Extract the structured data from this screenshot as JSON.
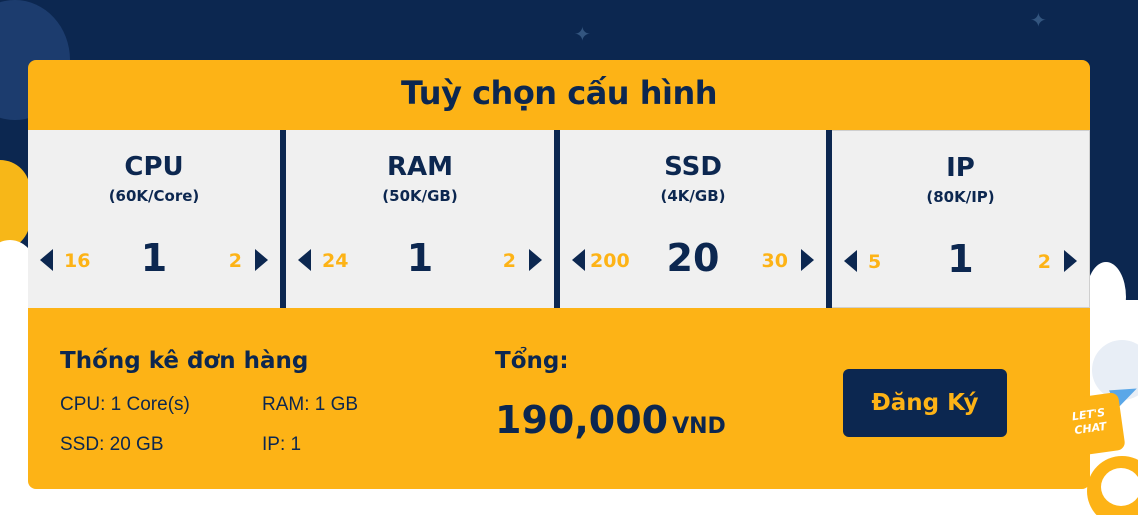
{
  "title": "Tuỳ chọn cấu hình",
  "options": [
    {
      "name": "CPU",
      "price": "(60K/Core)",
      "prev": "16",
      "value": "1",
      "next": "2"
    },
    {
      "name": "RAM",
      "price": "(50K/GB)",
      "prev": "24",
      "value": "1",
      "next": "2"
    },
    {
      "name": "SSD",
      "price": "(4K/GB)",
      "prev": "200",
      "value": "20",
      "next": "30"
    },
    {
      "name": "IP",
      "price": "(80K/IP)",
      "prev": "5",
      "value": "1",
      "next": "2"
    }
  ],
  "summary": {
    "title": "Thống kê đơn hàng",
    "cpu": "CPU:  1 Core(s)",
    "ram": "RAM:  1 GB",
    "ssd": "SSD:  20 GB",
    "ip": "IP:  1"
  },
  "total": {
    "label": "Tổng:",
    "value": "190,000",
    "unit": "VND"
  },
  "register_label": "Đăng Ký",
  "chat_badge": {
    "line1": "LET'S",
    "line2": "CHAT"
  },
  "colors": {
    "navy": "#0c2750",
    "accent": "#fdb316",
    "panel": "#f0f0f0"
  }
}
